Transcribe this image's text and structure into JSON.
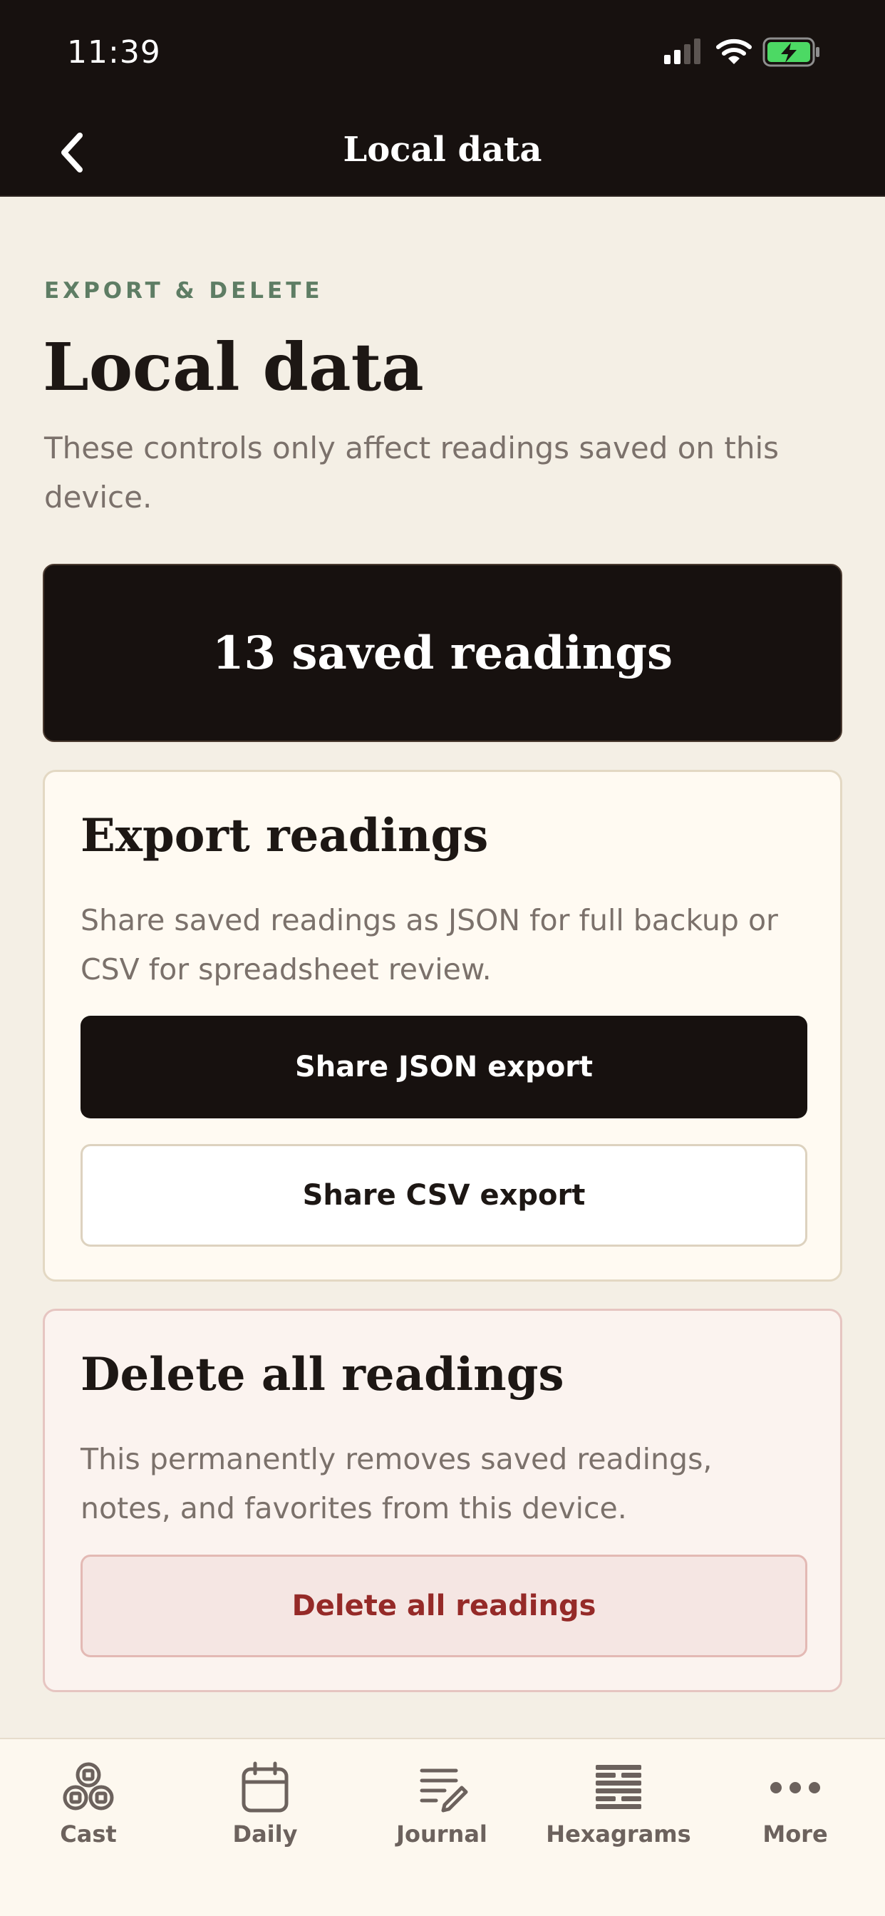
{
  "status_bar": {
    "time": "11:39"
  },
  "header": {
    "title": "Local data"
  },
  "intro": {
    "eyebrow": "EXPORT & DELETE",
    "title": "Local data",
    "description": "These controls only affect readings saved on this device."
  },
  "summary": {
    "count_text": "13 saved readings"
  },
  "export_card": {
    "title": "Export readings",
    "description": "Share saved readings as JSON for full backup or CSV for spreadsheet review.",
    "json_button": "Share JSON export",
    "csv_button": "Share CSV export"
  },
  "delete_card": {
    "title": "Delete all readings",
    "description": "This permanently removes saved readings, notes, and favorites from this device.",
    "delete_button": "Delete all readings"
  },
  "tab_bar": {
    "tabs": [
      {
        "label": "Cast",
        "icon": "coins-icon"
      },
      {
        "label": "Daily",
        "icon": "calendar-icon"
      },
      {
        "label": "Journal",
        "icon": "journal-pen-icon"
      },
      {
        "label": "Hexagrams",
        "icon": "hexagram-icon"
      },
      {
        "label": "More",
        "icon": "more-dots-icon"
      }
    ]
  },
  "colors": {
    "background": "#f4efe5",
    "header": "#17110f",
    "eyebrow": "#5e7d64",
    "danger_text": "#952a28",
    "battery_green": "#4cd964"
  }
}
